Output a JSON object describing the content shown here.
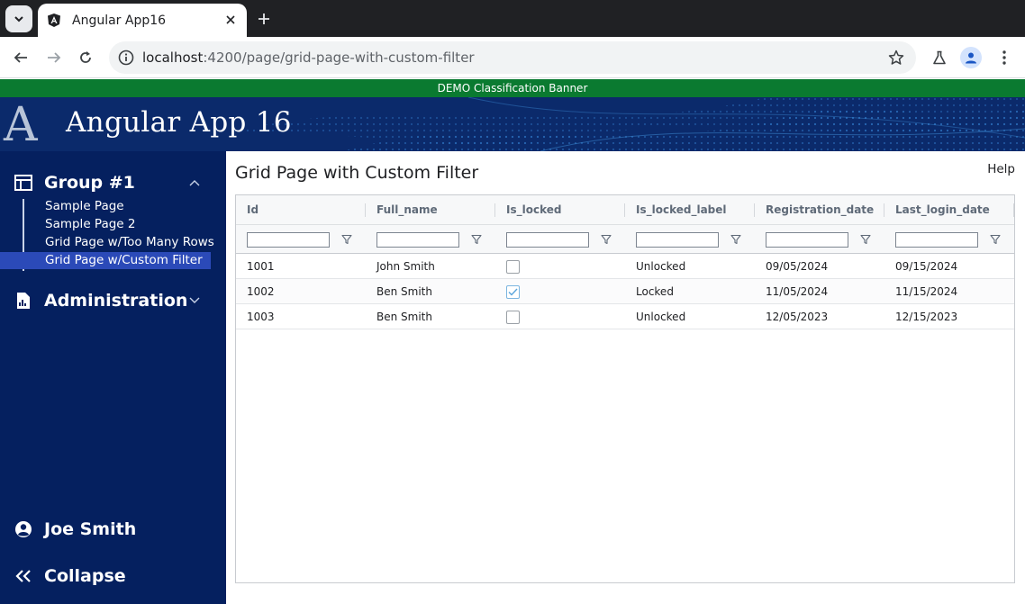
{
  "browser": {
    "tab_title": "Angular App16",
    "url_host": "localhost",
    "url_rest": ":4200/page/grid-page-with-custom-filter"
  },
  "app": {
    "banner": "DEMO Classification Banner",
    "logo_letter": "A",
    "title": "Angular App 16",
    "colors": {
      "banner_green": "#0a7a30",
      "header_blue": "#0b2a6b",
      "sidebar_blue": "#05205f",
      "active_item": "#2b4ab8"
    }
  },
  "sidebar": {
    "group1": {
      "icon": "panel-layout-icon",
      "label": "Group #1",
      "expanded": true,
      "items": [
        {
          "label": "Sample Page"
        },
        {
          "label": "Sample Page 2"
        },
        {
          "label": "Grid Page w/Too Many Rows"
        },
        {
          "label": "Grid Page w/Custom Filter",
          "active": true
        }
      ]
    },
    "admin": {
      "icon": "report-icon",
      "label": "Administration",
      "expanded": false
    },
    "user": {
      "icon": "account-circle-icon",
      "label": "Joe Smith"
    },
    "collapse": {
      "icon": "double-chevron-left-icon",
      "label": "Collapse"
    }
  },
  "main": {
    "title": "Grid Page with Custom Filter",
    "help": "Help"
  },
  "grid": {
    "columns": [
      "Id",
      "Full_name",
      "Is_locked",
      "Is_locked_label",
      "Registration_date",
      "Last_login_date"
    ],
    "rows": [
      {
        "id": "1001",
        "full_name": "John Smith",
        "is_locked": false,
        "label": "Unlocked",
        "registration": "09/05/2024",
        "last_login": "09/15/2024"
      },
      {
        "id": "1002",
        "full_name": "Ben Smith",
        "is_locked": true,
        "label": "Locked",
        "registration": "11/05/2024",
        "last_login": "11/15/2024"
      },
      {
        "id": "1003",
        "full_name": "Ben Smith",
        "is_locked": false,
        "label": "Unlocked",
        "registration": "12/05/2023",
        "last_login": "12/15/2023"
      }
    ]
  }
}
